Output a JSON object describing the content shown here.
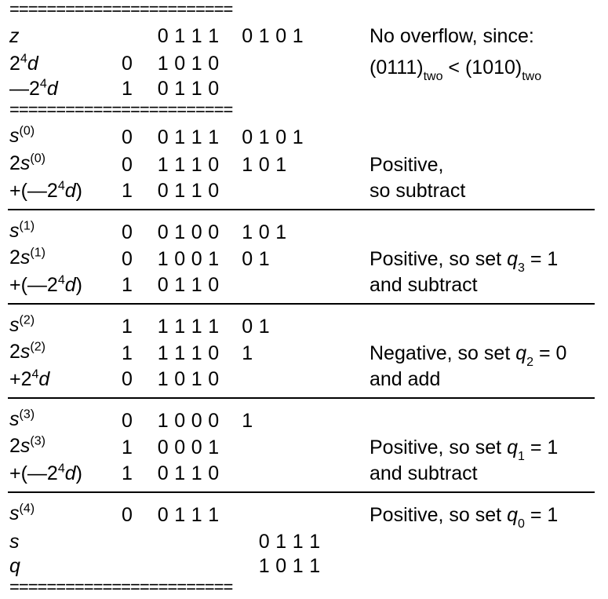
{
  "equals_rule": "========================",
  "header": {
    "rows": [
      {
        "label": "z",
        "sign": "",
        "bits": "0111",
        "bits2": "0101",
        "note": "No overflow, since:"
      },
      {
        "label": "2^4 d",
        "sign": "0",
        "bits": "1010",
        "bits2": "",
        "note": "(0111)two < (1010)two"
      },
      {
        "label": "—2^4 d",
        "sign": "1",
        "bits": "0110",
        "bits2": "",
        "note": ""
      }
    ]
  },
  "steps": [
    {
      "rows": [
        {
          "label": "s(0)",
          "sign": "0",
          "bits": "0111",
          "bits2": "0101",
          "note": ""
        },
        {
          "label": "2s(0)",
          "sign": "0",
          "bits": "1110",
          "bits2": "101",
          "note": "Positive,"
        },
        {
          "label": "+(—2^4d)",
          "sign": "1",
          "bits": "0110",
          "bits2": "",
          "note": "so subtract"
        }
      ]
    },
    {
      "rows": [
        {
          "label": "s(1)",
          "sign": "0",
          "bits": "0100",
          "bits2": "101",
          "note": ""
        },
        {
          "label": "2s(1)",
          "sign": "0",
          "bits": "1001",
          "bits2": "01",
          "note": "Positive, so set q3 = 1"
        },
        {
          "label": "+(—2^4d)",
          "sign": "1",
          "bits": "0110",
          "bits2": "",
          "note": "and subtract"
        }
      ]
    },
    {
      "rows": [
        {
          "label": "s(2)",
          "sign": "1",
          "bits": "1111",
          "bits2": "01",
          "note": ""
        },
        {
          "label": "2s(2)",
          "sign": "1",
          "bits": "1110",
          "bits2": "1",
          "note": "Negative, so set q2 = 0"
        },
        {
          "label": "+2^4 d",
          "sign": "0",
          "bits": "1010",
          "bits2": "",
          "note": "and add"
        }
      ]
    },
    {
      "rows": [
        {
          "label": "s(3)",
          "sign": "0",
          "bits": "1000",
          "bits2": "1",
          "note": ""
        },
        {
          "label": "2s(3)",
          "sign": "1",
          "bits": "0001",
          "bits2": "",
          "note": "Positive, so set q1 = 1"
        },
        {
          "label": "+(—2^4d)",
          "sign": "1",
          "bits": "0110",
          "bits2": "",
          "note": "and subtract"
        }
      ]
    },
    {
      "rows": [
        {
          "label": "s(4)",
          "sign": "0",
          "bits": "0111",
          "bits2": "",
          "note": "Positive, so set q0 = 1"
        },
        {
          "label": "s",
          "sign": "",
          "bits": "",
          "bits2": "0111",
          "note": ""
        },
        {
          "label": "q",
          "sign": "",
          "bits": "",
          "bits2": "1011",
          "note": ""
        }
      ]
    }
  ]
}
